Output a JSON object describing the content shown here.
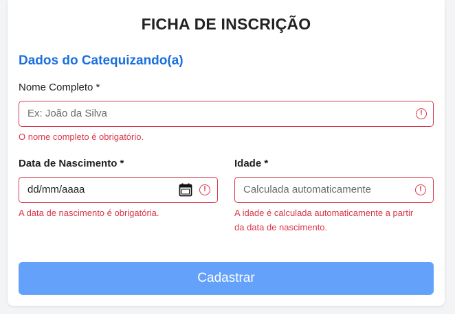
{
  "form": {
    "title": "FICHA DE INSCRIÇÃO",
    "section_title": "Dados do Catequizando(a)"
  },
  "fields": {
    "name": {
      "label": "Nome Completo *",
      "placeholder": "Ex: João da Silva",
      "error": "O nome completo é obrigatório."
    },
    "birthdate": {
      "label": "Data de Nascimento *",
      "value": "dd/mm/aaaa",
      "error": "A data de nascimento é obrigatória."
    },
    "age": {
      "label": "Idade *",
      "placeholder": "Calculada automaticamente",
      "error_line1": "A idade é calculada automaticamente a partir",
      "error_line2": "da data de nascimento."
    }
  },
  "actions": {
    "submit_label": "Cadastrar"
  },
  "icons": {
    "error": "error-circle-icon",
    "calendar": "calendar-icon"
  },
  "colors": {
    "accent": "#1a6fe0",
    "error": "#d9364a",
    "button": "#63a1fb",
    "button_text": "#ffffff"
  }
}
